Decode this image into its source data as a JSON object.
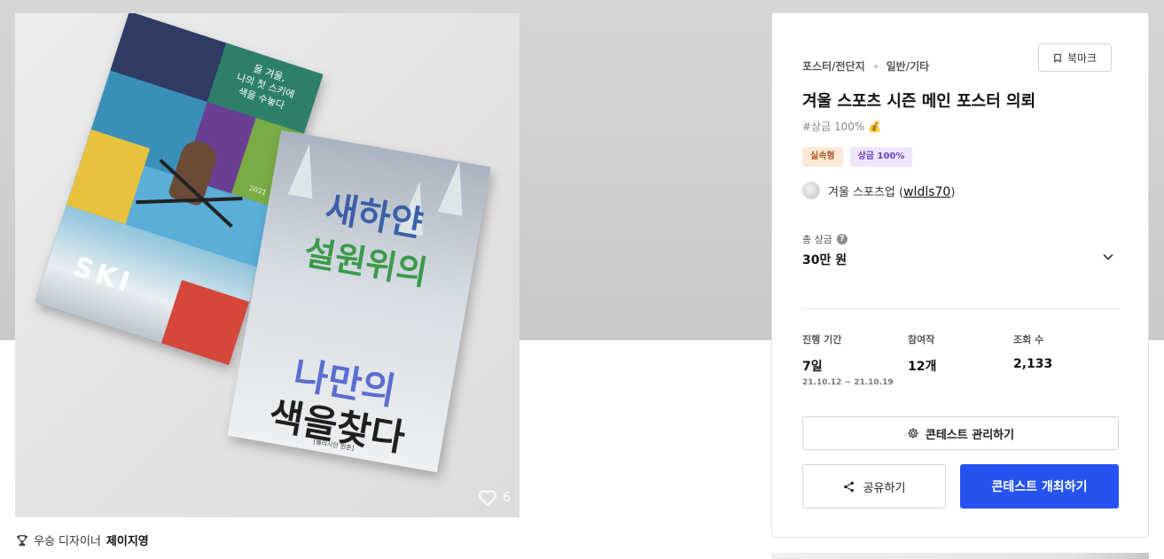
{
  "image": {
    "like_count": "6",
    "poster_a": {
      "text_lines": [
        "올 겨울,",
        "나의 첫 스키에",
        "색을 수놓다"
      ],
      "ski": "SKI",
      "year": "2021"
    },
    "poster_b": {
      "lines": [
        "새하얀",
        "설원위의",
        "나만의",
        "색을찾다"
      ],
      "footer": "[웰리시안 윈촌]"
    }
  },
  "winner": {
    "label": "우승 디자이너",
    "name": "제이지영"
  },
  "contest": {
    "category": "포스터/전단지",
    "subcategory": "일반/기타",
    "bookmark_label": "북마크",
    "title": "겨울 스포츠 시즌 메인 포스터 의뢰",
    "hashtag": "#상금 100% 💰",
    "badges": [
      "실속형",
      "상금 100%"
    ],
    "host_name": "겨울 스포츠업 (",
    "host_handle": "wldls70",
    "host_close": ")",
    "prize_label": "총 상금",
    "prize_value": "30만 원",
    "stats": {
      "period_label": "진행 기간",
      "period_value": "7일",
      "period_range": "21.10.12 ~ 21.10.19",
      "entries_label": "참여작",
      "entries_value": "12개",
      "views_label": "조회 수",
      "views_value": "2,133"
    },
    "manage_label": "콘테스트 관리하기",
    "share_label": "공유하기",
    "host_button_label": "콘테스트 개최하기",
    "colors": {
      "primary": "#2653f0",
      "badge_type_bg": "#fbe9d6",
      "badge_prize_bg": "#eee6fb"
    }
  }
}
